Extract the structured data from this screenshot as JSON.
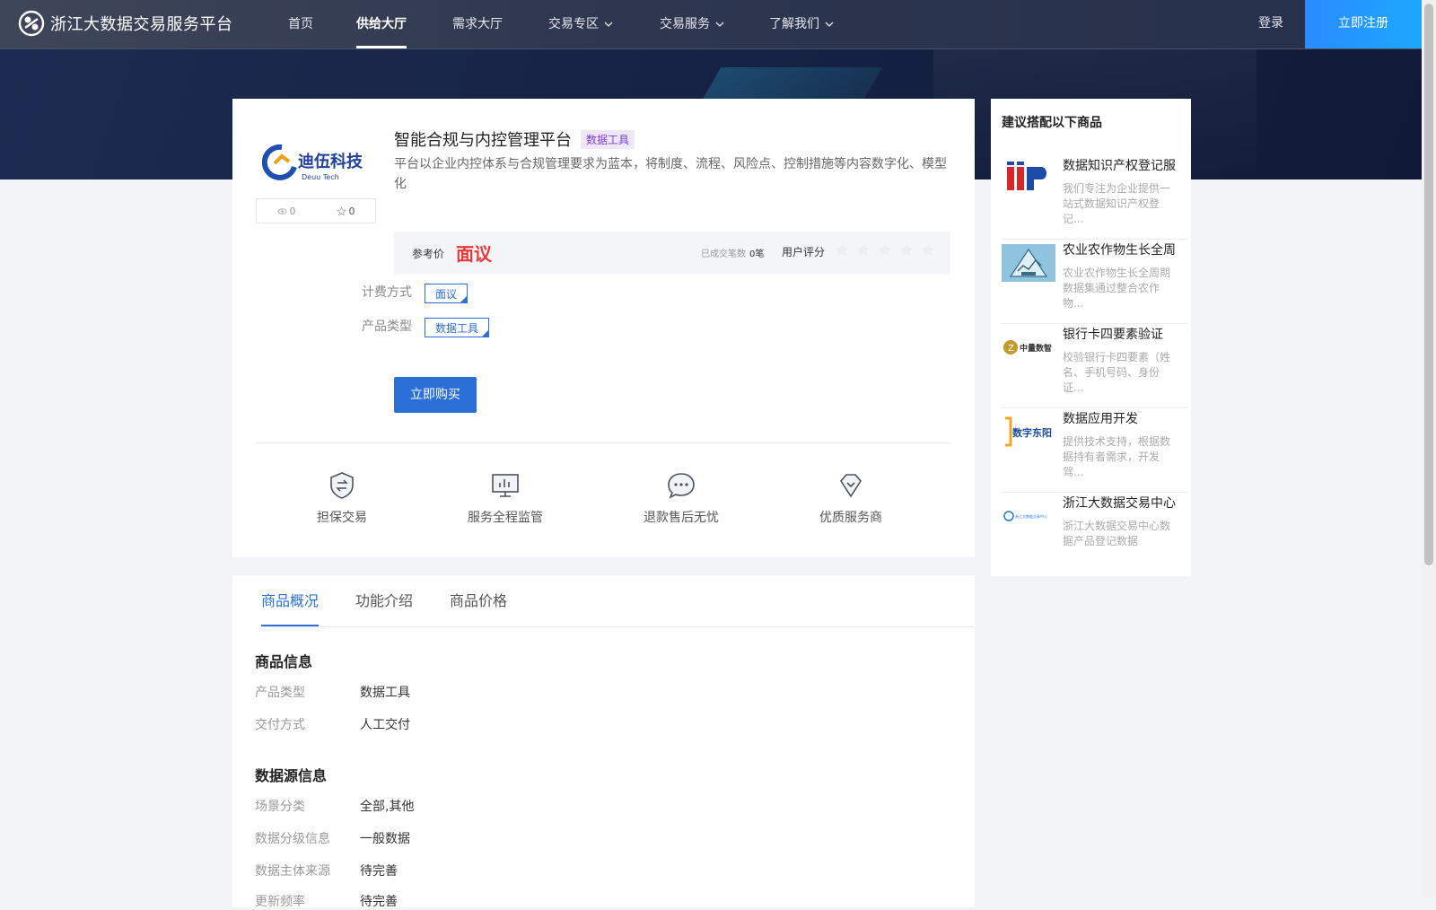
{
  "header": {
    "brand_name": "浙江大数据交易服务平台",
    "nav": [
      {
        "label": "首页"
      },
      {
        "label": "供给大厅",
        "active": true
      },
      {
        "label": "需求大厅"
      },
      {
        "label": "交易专区",
        "dropdown": true
      },
      {
        "label": "交易服务",
        "dropdown": true
      },
      {
        "label": "了解我们",
        "dropdown": true
      }
    ],
    "login": "登录",
    "register": "立即注册"
  },
  "product": {
    "logo_text": "迪伍科技",
    "logo_sub": "Deuu Tech",
    "views": "0",
    "favorites": "0",
    "title": "智能合规与内控管理平台",
    "tag": "数据工具",
    "description": "平台以企业内控体系与合规管理要求为蓝本，将制度、流程、风险点、控制措施等内容数字化、模型化",
    "price_label": "参考价",
    "price": "面议",
    "deals_label": "已成交笔数",
    "deals_value": "0笔",
    "rating_label": "用户评分",
    "rating": 0,
    "billing_label": "计费方式",
    "billing_value": "面议",
    "type_label": "产品类型",
    "type_value": "数据工具",
    "buy_button": "立即购买",
    "guarantees": [
      "担保交易",
      "服务全程监管",
      "退款售后无忧",
      "优质服务商"
    ]
  },
  "details": {
    "tabs": [
      "商品概况",
      "功能介绍",
      "商品价格"
    ],
    "active_tab": 0,
    "section1_title": "商品信息",
    "section1_rows": [
      {
        "label": "产品类型",
        "value": "数据工具"
      },
      {
        "label": "交付方式",
        "value": "人工交付"
      }
    ],
    "section2_title": "数据源信息",
    "section2_rows": [
      {
        "label": "场景分类",
        "value": "全部,其他"
      },
      {
        "label": "数据分级信息",
        "value": "一般数据"
      },
      {
        "label": "数据主体来源",
        "value": "待完善"
      },
      {
        "label": "更新频率",
        "value": "待完善"
      }
    ]
  },
  "recommendations": {
    "title": "建议搭配以下商品",
    "items": [
      {
        "name": "数据知识产权登记服",
        "desc": "我们专注为企业提供一站式数据知识产权登记...",
        "thumb": "iiP"
      },
      {
        "name": "农业农作物生长全周",
        "desc": "农业农作物生长全周期数据集通过整合农作物...",
        "thumb": "agri"
      },
      {
        "name": "银行卡四要素验证",
        "desc": "校验银行卡四要素（姓名、手机号码、身份证...",
        "thumb": "中量数智"
      },
      {
        "name": "数据应用开发",
        "desc": "提供技术支持，根据数据持有者需求，开发驾...",
        "thumb": "数字东阳"
      },
      {
        "name": "浙江大数据交易中心",
        "desc": "浙江大数据交易中心数据产品登记数据",
        "thumb": "浙江大数据交易中心"
      }
    ]
  },
  "colors": {
    "accent": "#2c6fd6",
    "price": "#e83a3a",
    "header_bg": "#2e3650",
    "register_bg": "#1ca8ff"
  }
}
